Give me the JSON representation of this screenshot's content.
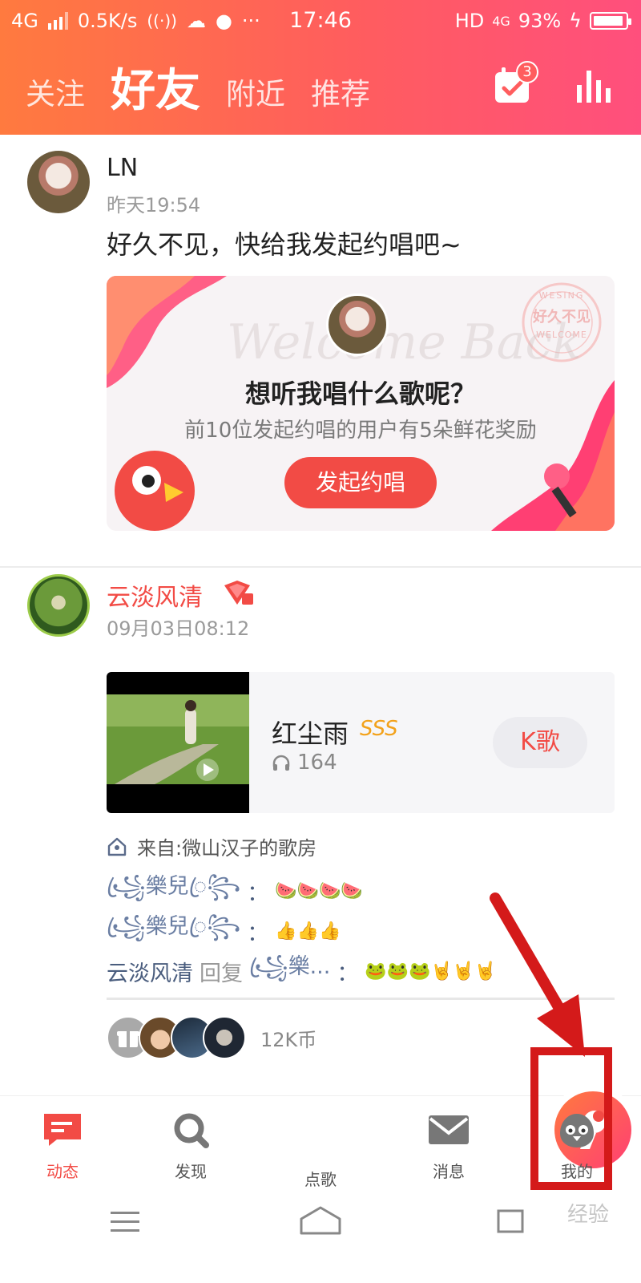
{
  "status_bar": {
    "network": "4G",
    "speed": "0.5K/s",
    "time": "17:46",
    "hd": "HD",
    "net_small": "4G",
    "battery": "93%",
    "more": "···"
  },
  "header": {
    "tabs": [
      {
        "label": "关注",
        "active": false
      },
      {
        "label": "好友",
        "active": true
      },
      {
        "label": "附近",
        "active": false
      },
      {
        "label": "推荐",
        "active": false
      }
    ],
    "calendar_badge": "3",
    "calendar_icon": "calendar-check-icon",
    "ranking_icon": "bar-chart-icon",
    "gradient": [
      "#ff7a3f",
      "#ff4f7d"
    ]
  },
  "post1": {
    "username": "LN",
    "time": "昨天19:54",
    "text": "好久不见，快给我发起约唱吧~",
    "card": {
      "watermark": "Welcome Back",
      "stamp_top": "WESING",
      "stamp_middle": "好久不见",
      "stamp_bottom": "WELCOME",
      "question": "想听我唱什么歌呢？",
      "subtitle": "前10位发起约唱的用户有5朵鲜花奖励",
      "button": "发起约唱"
    }
  },
  "post2": {
    "username": "云淡风清",
    "time": "09月03日08:12",
    "song": {
      "title": "红尘雨",
      "grade": "SSS",
      "plays": "164",
      "kge_button": "K歌"
    },
    "from": "来自:微山汉子的歌房",
    "comments": [
      {
        "user": "꧁ꦿ樂兒ꦿ꧂",
        "sep": "：",
        "emoji": "🍉🍉🍉🍉"
      },
      {
        "user": "꧁ꦿ樂兒ꦿ꧂",
        "sep": "：",
        "emoji": "👍👍👍"
      },
      {
        "user": "云淡风清",
        "reply": "回复",
        "target": "꧁ꦿ樂...",
        "sep": "：",
        "emoji": "🐸🐸🐸🤘🤘🤘"
      }
    ],
    "coins": "12K币"
  },
  "bottom_nav": [
    {
      "label": "动态",
      "icon": "chat-bubble-icon",
      "active": true
    },
    {
      "label": "发现",
      "icon": "search-icon",
      "active": false
    },
    {
      "label": "点歌",
      "icon": "microphone-icon",
      "active": false
    },
    {
      "label": "消息",
      "icon": "envelope-icon",
      "active": false
    },
    {
      "label": "我的",
      "icon": "profile-bird-icon",
      "active": false
    }
  ],
  "watermark": "经验",
  "colors": {
    "accent": "#f24b45",
    "annotation": "#d41a1a"
  }
}
